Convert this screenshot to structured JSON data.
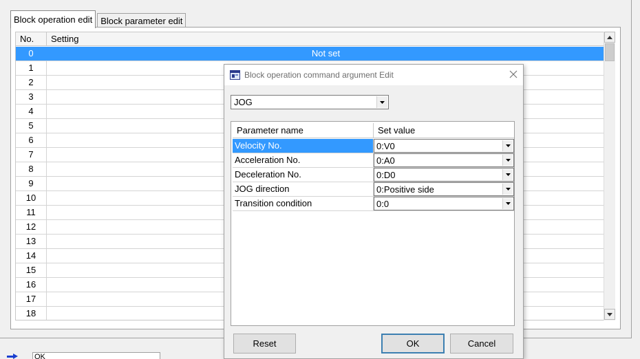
{
  "tabs": [
    {
      "label": "Block operation edit",
      "active": true
    },
    {
      "label": "Block parameter edit",
      "active": false
    }
  ],
  "grid": {
    "headers": {
      "no": "No.",
      "setting": "Setting"
    },
    "rows": [
      {
        "no": "0",
        "setting": "Not set",
        "selected": true
      },
      {
        "no": "1",
        "setting": ""
      },
      {
        "no": "2",
        "setting": ""
      },
      {
        "no": "3",
        "setting": ""
      },
      {
        "no": "4",
        "setting": ""
      },
      {
        "no": "5",
        "setting": ""
      },
      {
        "no": "6",
        "setting": ""
      },
      {
        "no": "7",
        "setting": ""
      },
      {
        "no": "8",
        "setting": ""
      },
      {
        "no": "9",
        "setting": ""
      },
      {
        "no": "10",
        "setting": ""
      },
      {
        "no": "11",
        "setting": ""
      },
      {
        "no": "12",
        "setting": ""
      },
      {
        "no": "13",
        "setting": ""
      },
      {
        "no": "14",
        "setting": ""
      },
      {
        "no": "15",
        "setting": ""
      },
      {
        "no": "16",
        "setting": ""
      },
      {
        "no": "17",
        "setting": ""
      },
      {
        "no": "18",
        "setting": ""
      }
    ]
  },
  "statusbar": {
    "text": "OK",
    "icon": "arrow-right-icon"
  },
  "dialog": {
    "title": "Block operation command argument Edit",
    "command": {
      "value": "JOG"
    },
    "param_table": {
      "headers": {
        "name": "Parameter name",
        "value": "Set value"
      },
      "rows": [
        {
          "name": "Velocity No.",
          "value": "0:V0",
          "selected": true
        },
        {
          "name": "Acceleration No.",
          "value": "0:A0"
        },
        {
          "name": "Deceleration No.",
          "value": "0:D0"
        },
        {
          "name": "JOG direction",
          "value": "0:Positive side"
        },
        {
          "name": "Transition condition",
          "value": "0:0"
        }
      ]
    },
    "buttons": {
      "reset": "Reset",
      "ok": "OK",
      "cancel": "Cancel"
    }
  },
  "colors": {
    "selection": "#3399ff",
    "accent": "#3c7fb1"
  }
}
